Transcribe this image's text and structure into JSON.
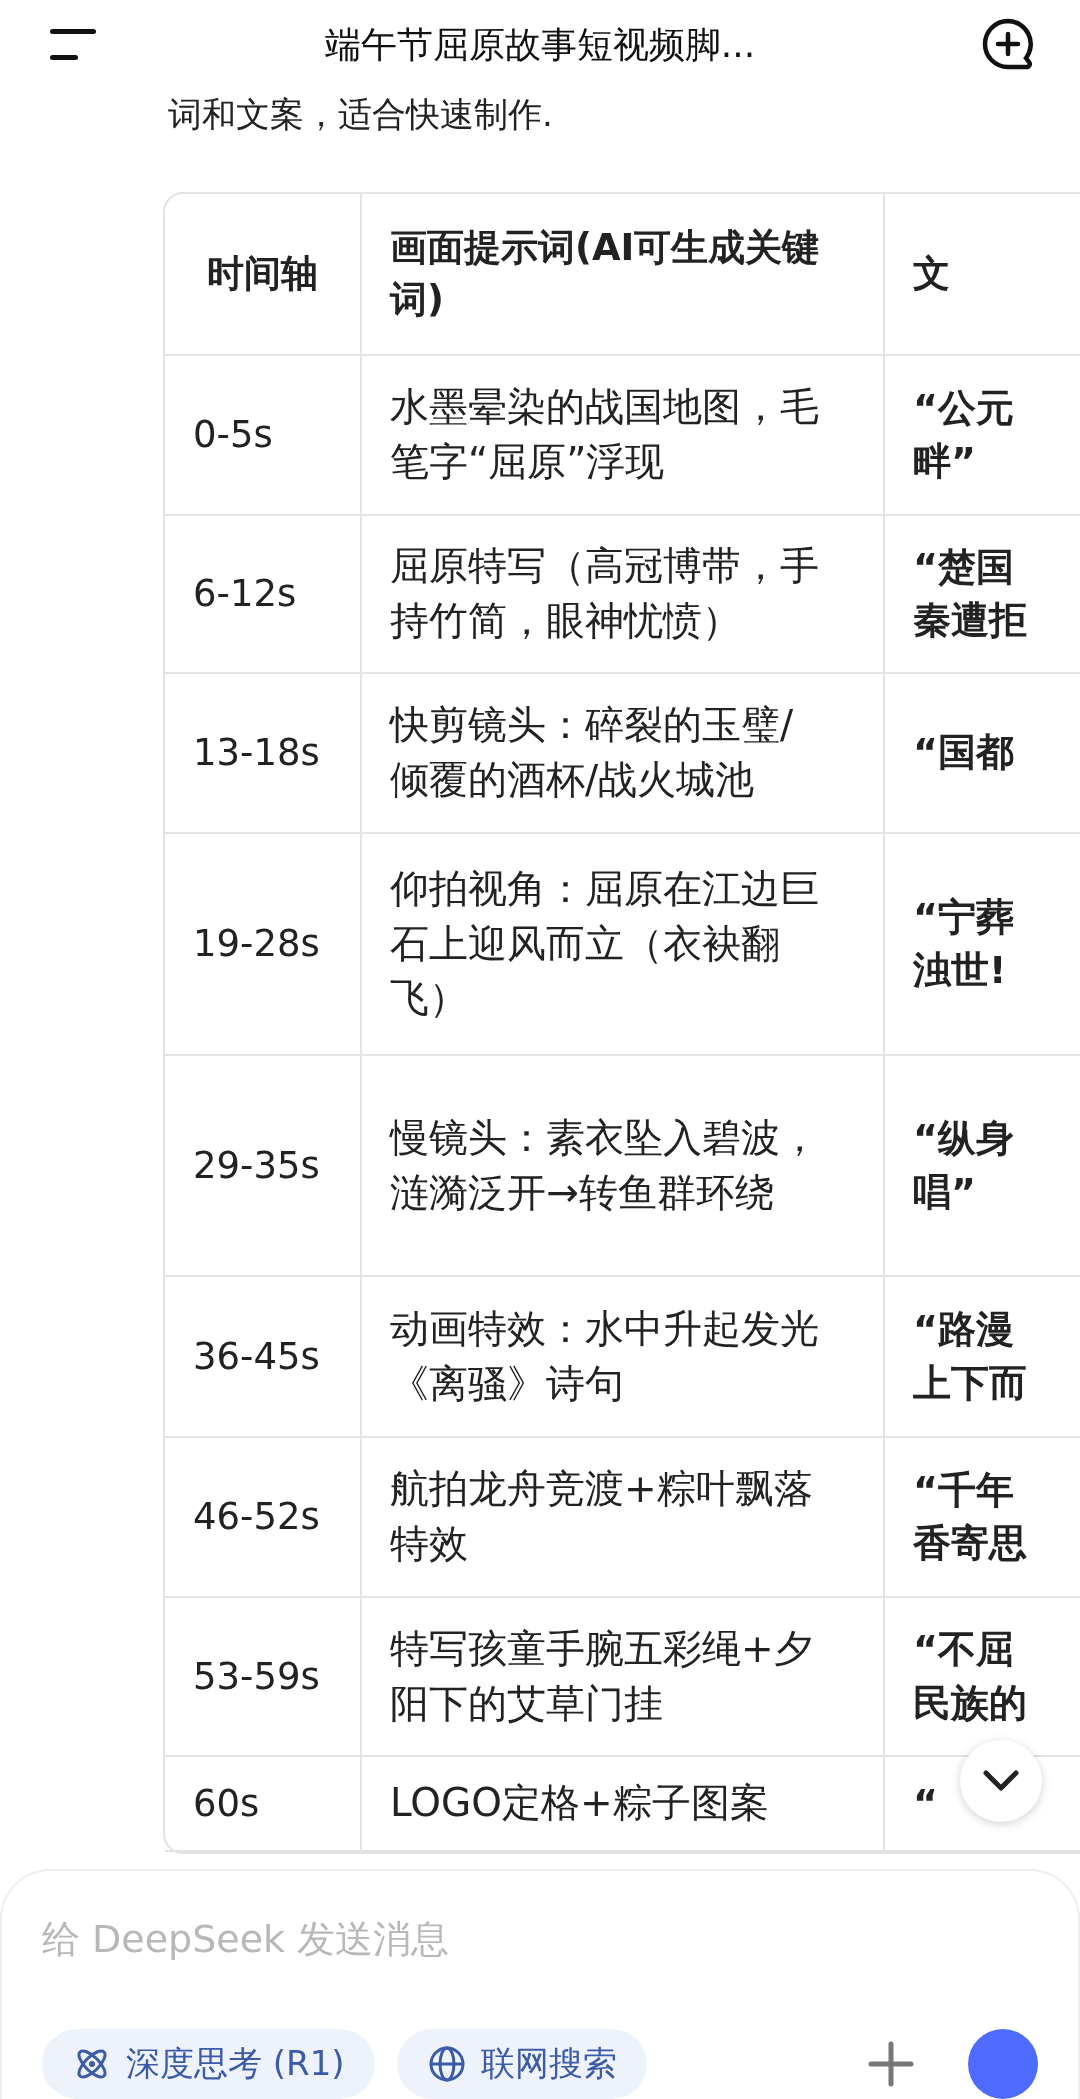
{
  "header": {
    "title": "端午节屈原故事短视频脚..."
  },
  "intro": "词和文案，适合快速制作.",
  "table": {
    "columns": [
      "时间轴",
      "画面提示词(AI可生成关键词)",
      "文"
    ],
    "rows": [
      {
        "time": "0-5s",
        "prompt": "水墨晕染的战国地图，毛笔字“屈原”浮现",
        "copy": [
          "“公元",
          "畔”"
        ]
      },
      {
        "time": "6-12s",
        "prompt": "屈原特写（高冠博带，手持竹简，眼神忧愤）",
        "copy": [
          "“楚国",
          "秦遭拒"
        ]
      },
      {
        "time": "13-18s",
        "prompt": "快剪镜头：碎裂的玉璧/倾覆的酒杯/战火城池",
        "copy": [
          "“国都"
        ]
      },
      {
        "time": "19-28s",
        "prompt": "仰拍视角：屈原在江边巨石上迎风而立（衣袂翻飞）",
        "copy": [
          "“宁葬",
          "浊世!"
        ]
      },
      {
        "time": "29-35s",
        "prompt": "慢镜头：素衣坠入碧波，涟漪泛开→转鱼群环绕",
        "copy": [
          "“纵身",
          "唱”"
        ]
      },
      {
        "time": "36-45s",
        "prompt": "动画特效：水中升起发光《离骚》诗句",
        "copy": [
          "“路漫",
          "上下而"
        ]
      },
      {
        "time": "46-52s",
        "prompt": "航拍龙舟竞渡+粽叶飘落特效",
        "copy": [
          "“千年",
          "香寄思"
        ]
      },
      {
        "time": "53-59s",
        "prompt": "特写孩童手腕五彩绳+夕阳下的艾草门挂",
        "copy": [
          "“不屈",
          "民族的"
        ]
      },
      {
        "time": "60s",
        "prompt": "LOGO定格+粽子图案",
        "copy": [
          "“"
        ]
      }
    ]
  },
  "composer": {
    "placeholder": "给 DeepSeek 发送消息",
    "chips": [
      "深度思考 (R1)",
      "联网搜索"
    ]
  }
}
